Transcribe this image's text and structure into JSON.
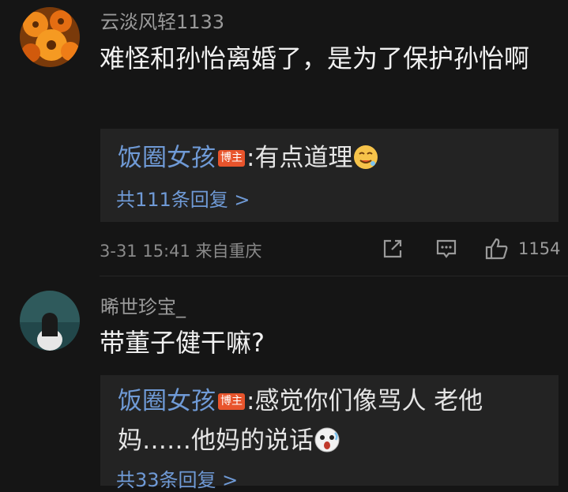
{
  "comments": [
    {
      "username": "云淡风轻1133",
      "text": "难怪和孙怡离婚了，是为了保护孙怡啊",
      "reply": {
        "author": "饭圈女孩",
        "badge": "博主",
        "text": ":有点道理",
        "emoji": "drooling-emoji"
      },
      "reply_count": "共111条回复 >",
      "meta": "3-31 15:41 来自重庆",
      "actions": {
        "share_icon": "share-icon",
        "comment_icon": "comment-icon",
        "like_icon": "like-icon",
        "like_count": "1154"
      }
    },
    {
      "username": "晞世珍宝_",
      "text": "带董子健干嘛?",
      "reply": {
        "author": "饭圈女孩",
        "badge": "博主",
        "text": ":感觉你们像骂人 老他妈……他妈的说话",
        "emoji": "shocked-emoji"
      },
      "reply_count": "共33条回复 >"
    }
  ],
  "colors": {
    "background": "#151515",
    "reply_background": "#232323",
    "link_blue": "#6f9ad6",
    "badge_orange": "#e8542c"
  }
}
